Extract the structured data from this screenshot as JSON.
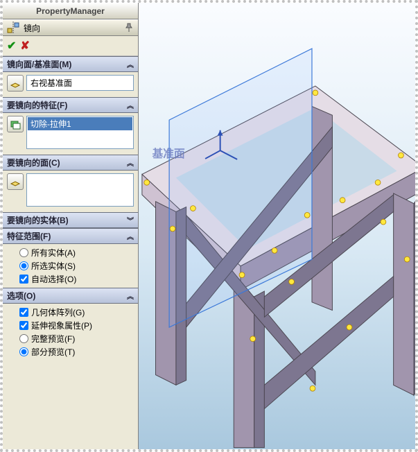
{
  "titlebar": "PropertyManager",
  "feature": {
    "name": "镜向"
  },
  "confirm": {
    "ok": "✔",
    "cancel": "✘"
  },
  "sections": {
    "mirror_plane": {
      "title": "镜向面/基准面(M)",
      "value": "右视基准面"
    },
    "features": {
      "title": "要镜向的特征(F)",
      "items": [
        "切除-拉伸1"
      ]
    },
    "faces": {
      "title": "要镜向的面(C)"
    },
    "bodies": {
      "title": "要镜向的实体(B)"
    },
    "scope": {
      "title": "特征范围(F)",
      "radios": [
        {
          "label": "所有实体(A)",
          "checked": false
        },
        {
          "label": "所选实体(S)",
          "checked": true
        }
      ],
      "autosel": {
        "label": "自动选择(O)",
        "checked": true
      }
    },
    "options": {
      "title": "选项(O)",
      "checks": [
        {
          "label": "几何体阵列(G)",
          "checked": true
        },
        {
          "label": "延伸视象属性(P)",
          "checked": true
        }
      ],
      "previews": [
        {
          "label": "完整预览(F)",
          "checked": false
        },
        {
          "label": "部分预览(T)",
          "checked": true
        }
      ]
    }
  },
  "viewport": {
    "plane_label": "基准面"
  }
}
